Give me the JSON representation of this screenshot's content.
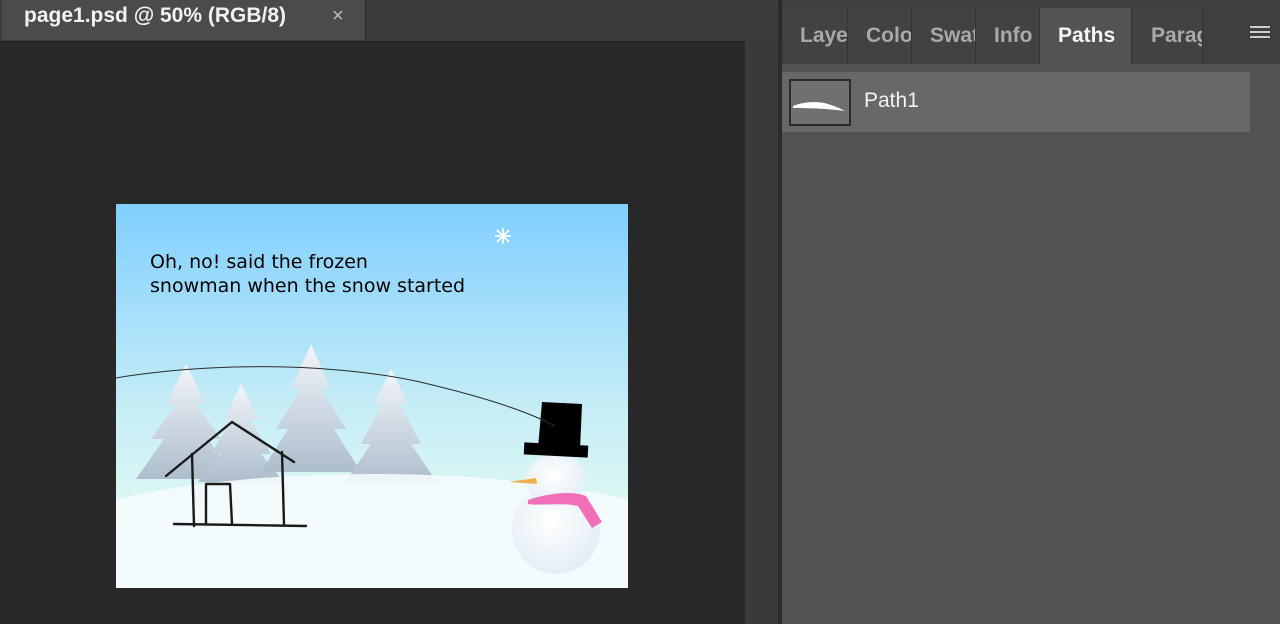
{
  "document": {
    "tab_title": "page1.psd @ 50% (RGB/8)",
    "close_glyph": "×",
    "canvas": {
      "text_line1": "Oh, no! said the frozen",
      "text_line2": "snowman when the snow started"
    }
  },
  "panel": {
    "tabs": [
      {
        "label": "Layers",
        "active": false
      },
      {
        "label": "Color",
        "active": false
      },
      {
        "label": "Swatches",
        "active": false
      },
      {
        "label": "Info",
        "active": false
      },
      {
        "label": "Paths",
        "active": true
      },
      {
        "label": "Paragraph",
        "active": false
      }
    ],
    "menu_icon": "hamburger-icon",
    "paths": [
      {
        "name": "Path1"
      }
    ]
  },
  "colors": {
    "sky_top": "#80CFFF",
    "sky_bottom": "#D8F7F5",
    "snow": "#F2FBFD",
    "scarf": "#F070B8",
    "nose": "#F0B050"
  }
}
